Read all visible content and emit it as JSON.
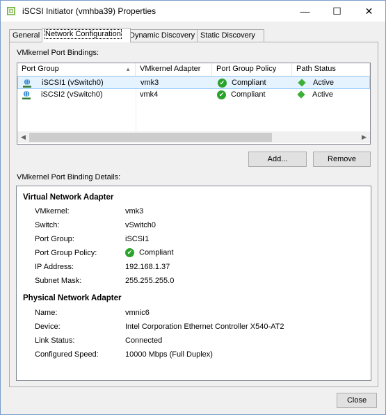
{
  "window": {
    "title": "iSCSI Initiator (vmhba39) Properties",
    "min_glyph": "—",
    "max_glyph": "☐",
    "close_glyph": "✕"
  },
  "tabs": [
    {
      "label": "General"
    },
    {
      "label": "Network Configuration",
      "active": true
    },
    {
      "label": "Dynamic Discovery"
    },
    {
      "label": "Static Discovery"
    }
  ],
  "bindings": {
    "label": "VMkernel Port Bindings:",
    "columns": [
      "Port Group",
      "VMkernel Adapter",
      "Port Group Policy",
      "Path Status"
    ],
    "rows": [
      {
        "port_group": "iSCSI1 (vSwitch0)",
        "adapter": "vmk3",
        "policy": "Compliant",
        "path_status": "Active",
        "selected": true
      },
      {
        "port_group": "iSCSI2 (vSwitch0)",
        "adapter": "vmk4",
        "policy": "Compliant",
        "path_status": "Active",
        "selected": false
      }
    ]
  },
  "buttons": {
    "add": "Add...",
    "remove": "Remove",
    "close": "Close"
  },
  "details": {
    "label": "VMkernel Port Binding Details:",
    "virtual_title": "Virtual Network Adapter",
    "virtual": [
      {
        "key": "VMkernel:",
        "value": "vmk3"
      },
      {
        "key": "Switch:",
        "value": "vSwitch0"
      },
      {
        "key": "Port Group:",
        "value": "iSCSI1"
      },
      {
        "key": "Port Group Policy:",
        "value": "Compliant"
      },
      {
        "key": "IP Address:",
        "value": "192.168.1.37"
      },
      {
        "key": "Subnet Mask:",
        "value": "255.255.255.0"
      }
    ],
    "physical_title": "Physical Network Adapter",
    "physical": [
      {
        "key": "Name:",
        "value": "vmnic6"
      },
      {
        "key": "Device:",
        "value": "Intel Corporation Ethernet Controller X540-AT2"
      },
      {
        "key": "Link Status:",
        "value": "Connected"
      },
      {
        "key": "Configured Speed:",
        "value": "10000 Mbps (Full Duplex)"
      }
    ]
  },
  "colors": {
    "accent": "#2aa32a",
    "selection": "#e5f3ff",
    "selection_border": "#99d1ff",
    "window_border": "#7a9cc8"
  }
}
